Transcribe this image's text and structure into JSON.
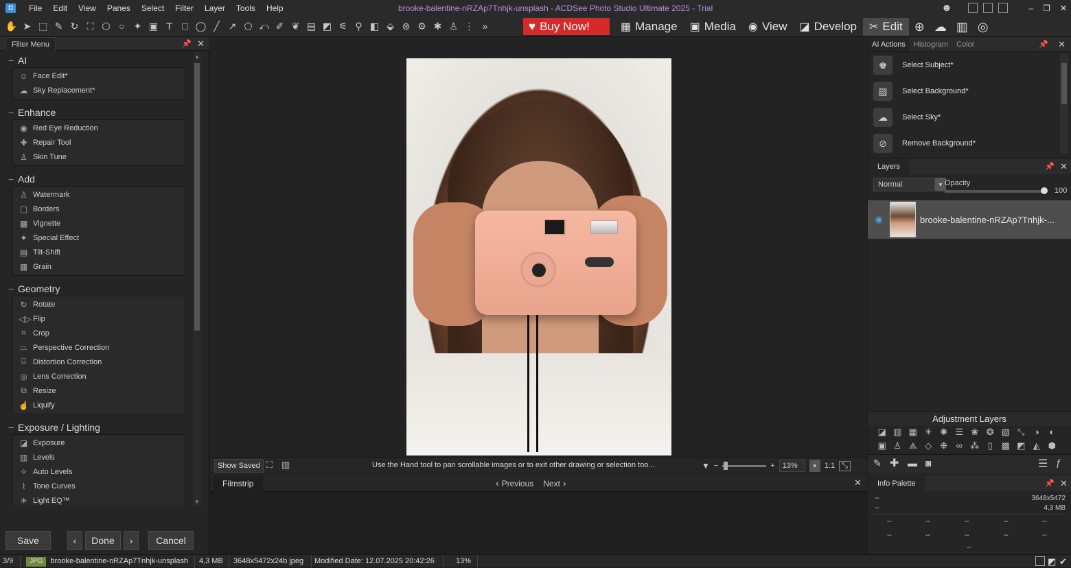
{
  "window": {
    "title": "brooke-balentine-nRZAp7Tnhjk-unsplash - ACDSee Photo Studio Ultimate 2025 - Trial",
    "menu": [
      "File",
      "Edit",
      "View",
      "Panes",
      "Select",
      "Filter",
      "Layer",
      "Tools",
      "Help"
    ]
  },
  "toolbar": {
    "buy_now": "Buy Now!",
    "modes": [
      {
        "label": "Manage",
        "icon": "grid-icon"
      },
      {
        "label": "Media",
        "icon": "media-icon"
      },
      {
        "label": "View",
        "icon": "eye-icon"
      },
      {
        "label": "Develop",
        "icon": "develop-icon"
      },
      {
        "label": "Edit",
        "icon": "edit-icon"
      }
    ]
  },
  "filter_menu": {
    "tab": "Filter Menu",
    "groups": [
      {
        "title": "AI",
        "items": [
          "Face Edit*",
          "Sky Replacement*"
        ]
      },
      {
        "title": "Enhance",
        "items": [
          "Red Eye Reduction",
          "Repair Tool",
          "Skin Tune"
        ]
      },
      {
        "title": "Add",
        "items": [
          "Watermark",
          "Borders",
          "Vignette",
          "Special Effect",
          "Tilt-Shift",
          "Grain"
        ]
      },
      {
        "title": "Geometry",
        "items": [
          "Rotate",
          "Flip",
          "Crop",
          "Perspective Correction",
          "Distortion Correction",
          "Lens Correction",
          "Resize",
          "Liquify"
        ]
      },
      {
        "title": "Exposure / Lighting",
        "items": [
          "Exposure",
          "Levels",
          "Auto Levels",
          "Tone Curves",
          "Light EQ™"
        ]
      }
    ],
    "buttons": {
      "save": "Save",
      "done": "Done",
      "cancel": "Cancel"
    }
  },
  "canvas": {
    "show_saved": "Show Saved",
    "hint": "Use the Hand tool to pan scrollable images or to exit other drawing or selection too...",
    "zoom": "13%",
    "ratio": "1:1"
  },
  "filmstrip": {
    "tab": "Filmstrip",
    "previous": "Previous",
    "next": "Next"
  },
  "right": {
    "tabs": [
      "AI Actions",
      "Histogram",
      "Color"
    ],
    "ai_actions": [
      "Select Subject*",
      "Select Background*",
      "Select Sky*",
      "Remove Background*"
    ],
    "layers": {
      "tab": "Layers",
      "blend": "Normal",
      "opacity_label": "Opacity",
      "opacity": "100",
      "layer_name": "brooke-balentine-nRZAp7Tnhjk-..."
    },
    "adjustment_layers": "Adjustment Layers",
    "info": {
      "tab": "Info Palette",
      "dimensions": "3648x5472",
      "size": "4,3 MB",
      "dash": "--"
    }
  },
  "status": {
    "index": "3/9",
    "format": "JPG",
    "filename": "brooke-balentine-nRZAp7Tnhjk-unsplash",
    "filesize": "4,3 MB",
    "dims": "3648x5472x24b jpeg",
    "modified": "Modified Date: 12.07.2025 20:42:26",
    "zoom": "13%"
  }
}
